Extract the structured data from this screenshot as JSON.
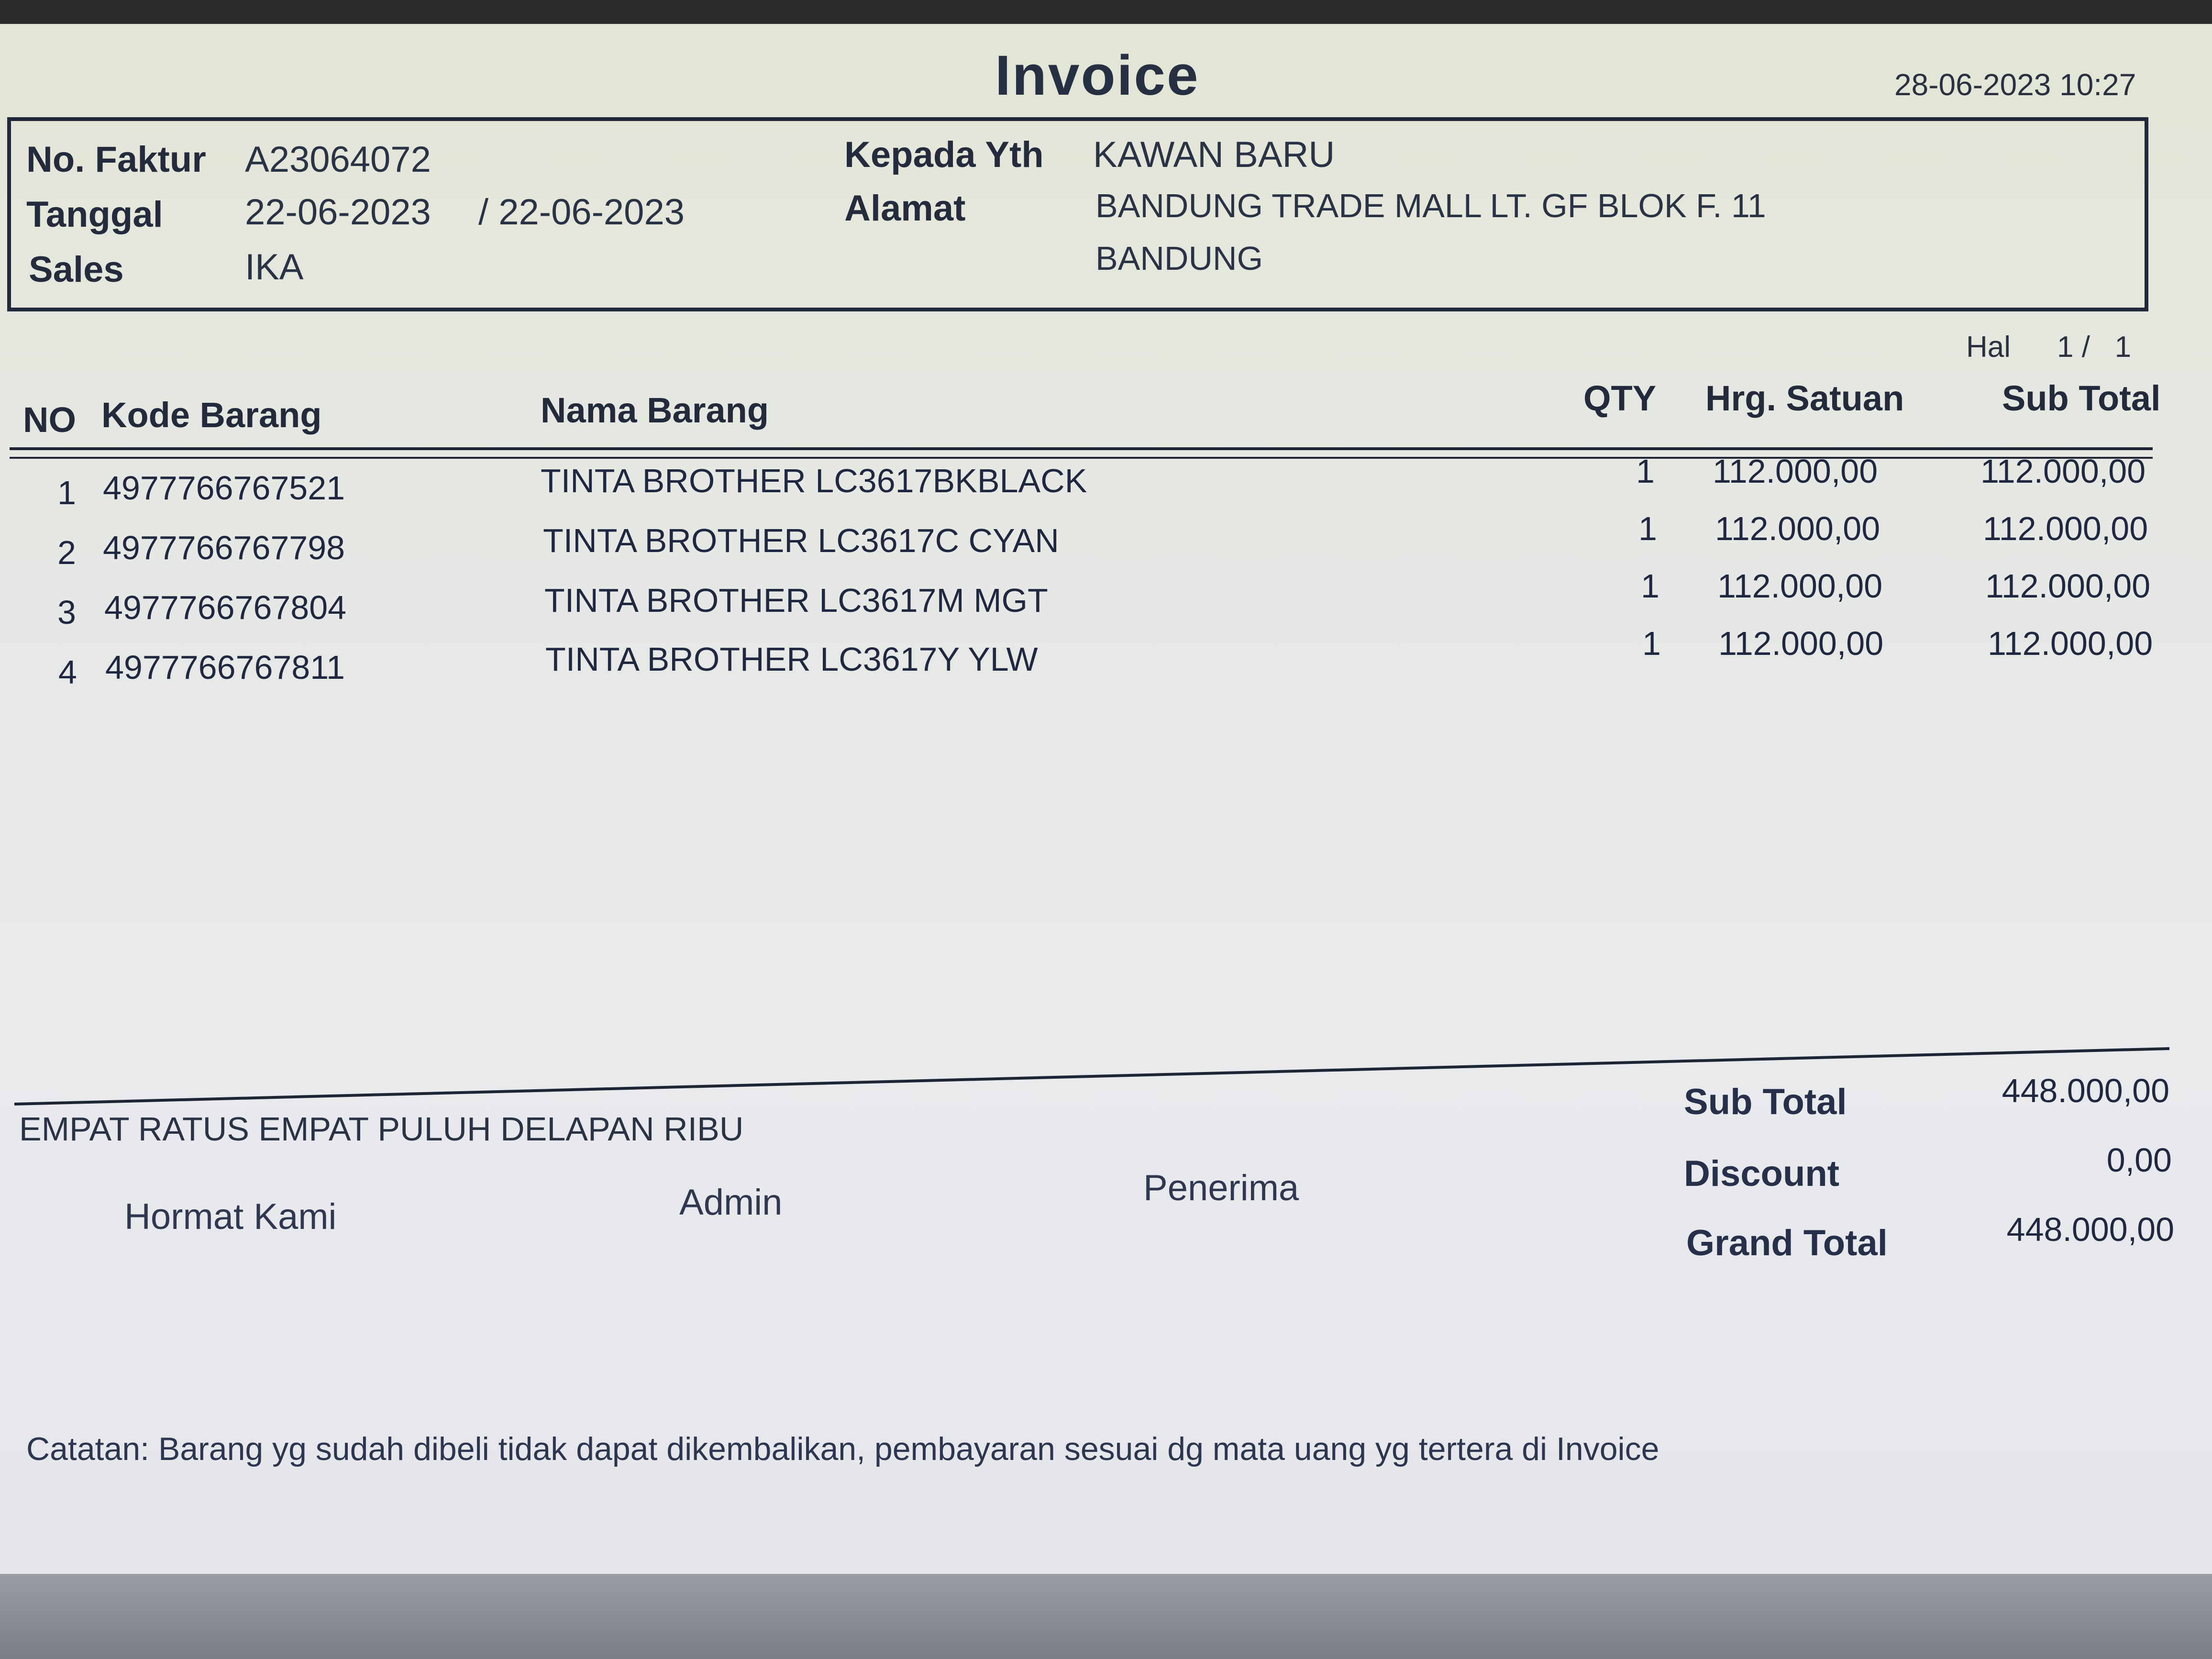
{
  "invoice": {
    "title": "Invoice",
    "printed_datetime": "28-06-2023 10:27"
  },
  "header": {
    "no_faktur_label": "No. Faktur",
    "no_faktur": "A23064072",
    "tanggal_label": "Tanggal",
    "tanggal": "22-06-2023",
    "tanggal2": "/ 22-06-2023",
    "sales_label": "Sales",
    "sales": "IKA",
    "kepada_label": "Kepada Yth",
    "kepada": "KAWAN BARU",
    "alamat_label": "Alamat",
    "alamat_line1": "BANDUNG TRADE MALL LT. GF BLOK F. 11",
    "alamat_line2": "BANDUNG"
  },
  "page": {
    "label": "Hal",
    "value": "1 /   1"
  },
  "table": {
    "columns": {
      "no": "NO",
      "kode": "Kode Barang",
      "nama": "Nama Barang",
      "qty": "QTY",
      "harga": "Hrg. Satuan",
      "subtotal": "Sub Total"
    },
    "rows": [
      {
        "no": "1",
        "kode": "4977766767521",
        "nama": "TINTA BROTHER LC3617BKBLACK",
        "qty": "1",
        "harga": "112.000,00",
        "subtotal": "112.000,00"
      },
      {
        "no": "2",
        "kode": "4977766767798",
        "nama": "TINTA BROTHER LC3617C CYAN",
        "qty": "1",
        "harga": "112.000,00",
        "subtotal": "112.000,00"
      },
      {
        "no": "3",
        "kode": "4977766767804",
        "nama": "TINTA BROTHER LC3617M MGT",
        "qty": "1",
        "harga": "112.000,00",
        "subtotal": "112.000,00"
      },
      {
        "no": "4",
        "kode": "4977766767811",
        "nama": "TINTA BROTHER LC3617Y YLW",
        "qty": "1",
        "harga": "112.000,00",
        "subtotal": "112.000,00"
      }
    ]
  },
  "footer": {
    "terbilang": "EMPAT RATUS EMPAT PULUH DELAPAN RIBU",
    "hormat_kami": "Hormat Kami",
    "admin": "Admin",
    "penerima": "Penerima",
    "catatan": "Catatan: Barang yg sudah dibeli tidak dapat dikembalikan, pembayaran sesuai dg mata uang yg tertera di Invoice"
  },
  "totals": {
    "sub_total_label": "Sub Total",
    "sub_total": "448.000,00",
    "discount_label": "Discount",
    "discount": "0,00",
    "grand_total_label": "Grand Total",
    "grand_total": "448.000,00"
  }
}
